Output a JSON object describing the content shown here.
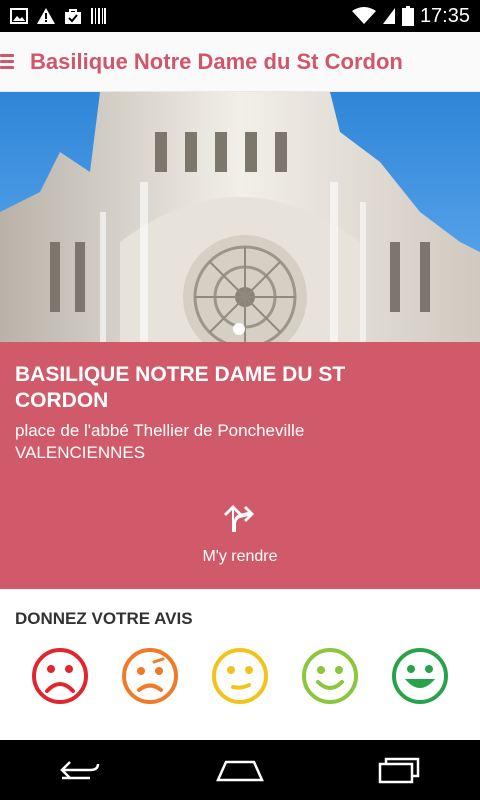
{
  "status_bar": {
    "time": "17:35"
  },
  "app_bar": {
    "title": "Basilique Notre Dame du St Cordon"
  },
  "place": {
    "name": "BASILIQUE NOTRE DAME DU ST CORDON",
    "address_line1": "place de l'abbé Thellier de Poncheville",
    "address_line2": "VALENCIENNES"
  },
  "directions": {
    "label": "M'y rendre"
  },
  "rating": {
    "title": "DONNEZ VOTRE AVIS",
    "faces": [
      {
        "name": "very-unhappy-face-icon",
        "color": "#e0272f"
      },
      {
        "name": "unhappy-face-icon",
        "color": "#ef7a27"
      },
      {
        "name": "neutral-face-icon",
        "color": "#f0c41b"
      },
      {
        "name": "happy-face-icon",
        "color": "#8cc63f"
      },
      {
        "name": "very-happy-face-icon",
        "color": "#2aa24c"
      }
    ]
  },
  "colors": {
    "accent": "#d0566a",
    "info_bg": "#d05a6a"
  }
}
